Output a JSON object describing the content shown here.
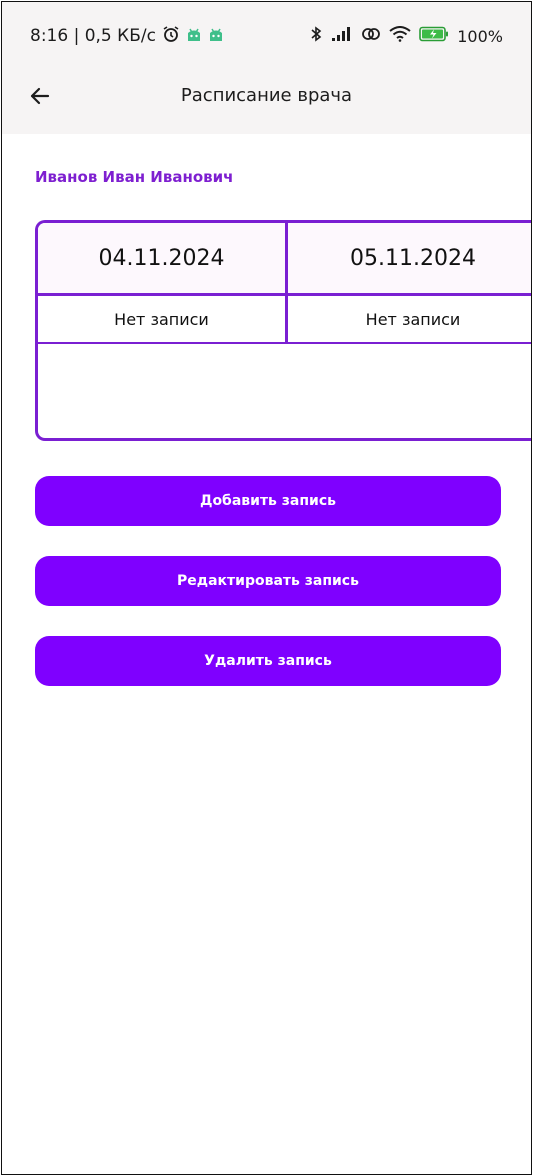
{
  "status_bar": {
    "time_speed": "8:16 | 0,5 КБ/с",
    "battery": "100%"
  },
  "header": {
    "title": "Расписание врача"
  },
  "doctor_name": "Иванов Иван Иванович",
  "schedule": {
    "columns": [
      {
        "date": "04.11.2024",
        "status": "Нет записи"
      },
      {
        "date": "05.11.2024",
        "status": "Нет записи"
      }
    ]
  },
  "actions": {
    "add": "Добавить запись",
    "edit": "Редактировать запись",
    "delete": "Удалить запись"
  },
  "colors": {
    "accent": "#7f00ff",
    "border": "#7a1fd2",
    "doctor_text": "#7e1fd0"
  }
}
